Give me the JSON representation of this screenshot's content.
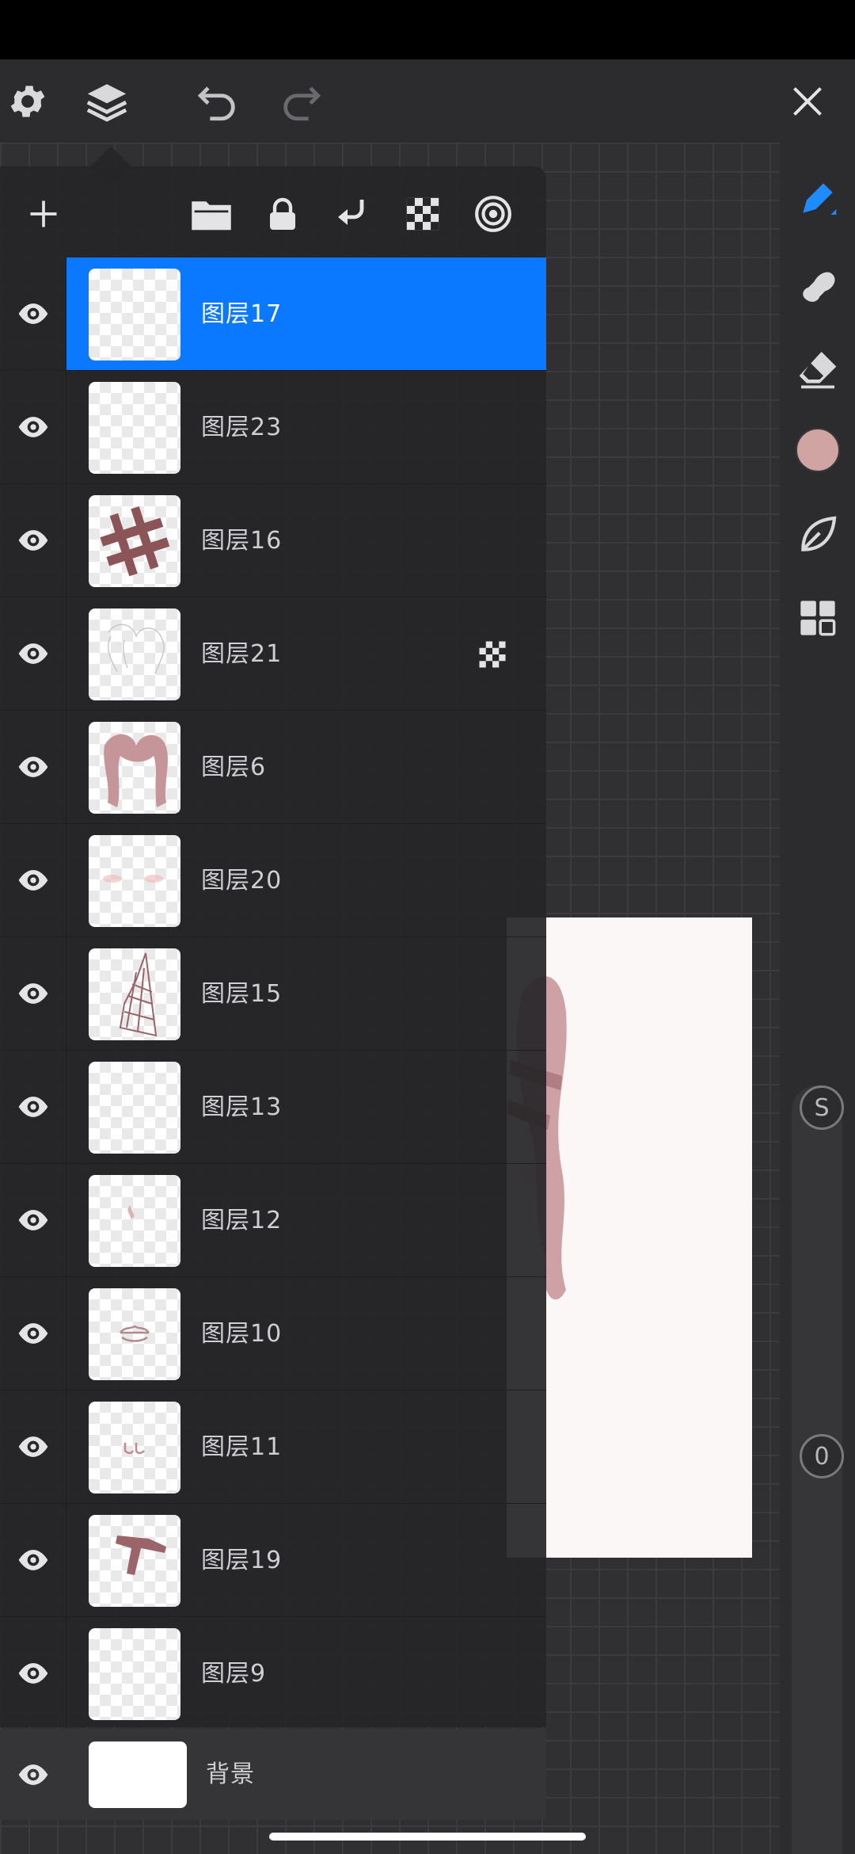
{
  "topbar": {
    "settings_icon": "gear-icon",
    "layers_icon": "layers-icon",
    "undo_icon": "undo-icon",
    "redo_icon": "redo-icon",
    "close_icon": "close-icon"
  },
  "layers_toolbar": {
    "add_icon": "plus-icon",
    "folder_icon": "folder-icon",
    "lock_icon": "lock-icon",
    "merge_icon": "merge-down-icon",
    "alpha_icon": "checkerboard-icon",
    "blend_icon": "target-icon"
  },
  "layers": [
    {
      "name": "图层17",
      "selected": true
    },
    {
      "name": "图层23"
    },
    {
      "name": "图层16"
    },
    {
      "name": "图层21",
      "badge": "checkerboard-icon"
    },
    {
      "name": "图层6"
    },
    {
      "name": "图层20"
    },
    {
      "name": "图层15"
    },
    {
      "name": "图层13"
    },
    {
      "name": "图层12"
    },
    {
      "name": "图层10"
    },
    {
      "name": "图层11"
    },
    {
      "name": "图层19"
    },
    {
      "name": "图层9"
    },
    {
      "name": "背景",
      "background": true
    }
  ],
  "right_toolbar": {
    "tools": [
      "pen-icon",
      "smudge-icon",
      "eraser-icon",
      "color-swatch",
      "leaf-icon",
      "grid-icon"
    ],
    "color": "#d1a4a4",
    "size_label": "S",
    "opacity_label": "0"
  },
  "colors": {
    "accent": "#0a78ff",
    "panel": "#262628"
  }
}
